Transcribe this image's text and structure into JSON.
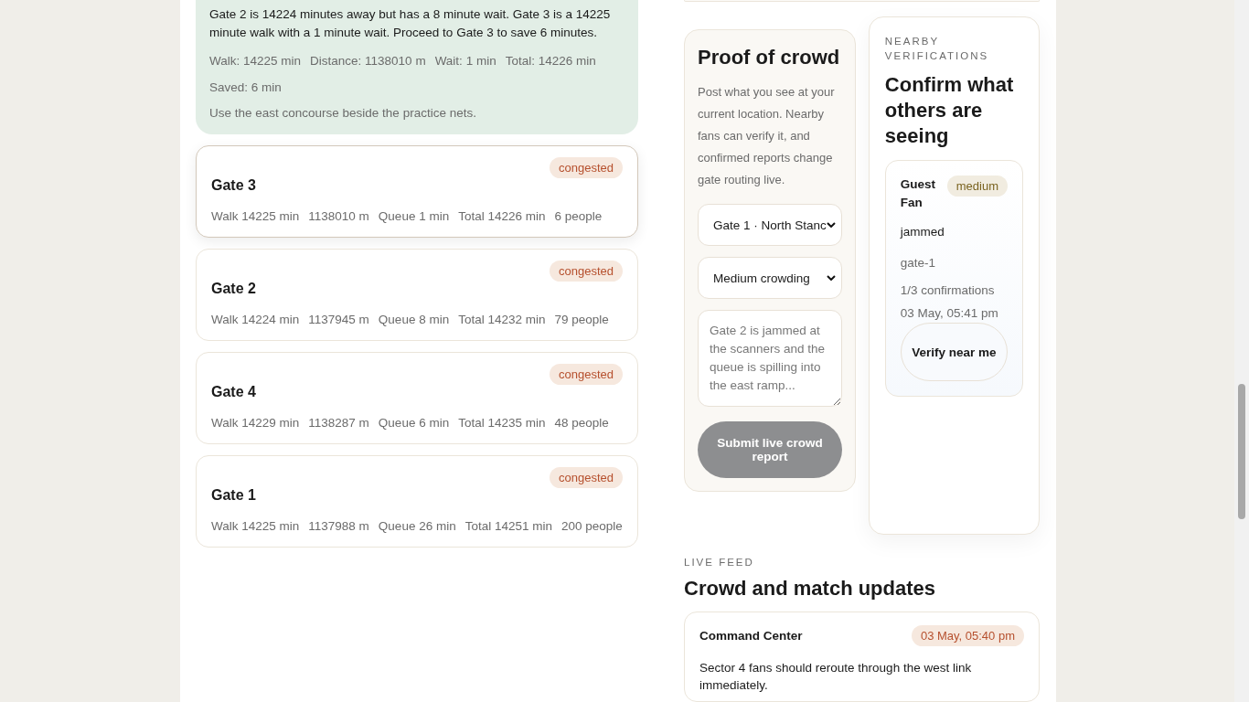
{
  "recommendation": {
    "message": "Gate 2 is 14224 minutes away but has a 8 minute wait. Gate 3 is a 14225 minute walk with a 1 minute wait. Proceed to Gate 3 to save 6 minutes.",
    "stats": [
      "Walk: 14225 min",
      "Distance: 1138010 m",
      "Wait: 1 min",
      "Total: 14226 min",
      "Saved: 6 min"
    ],
    "note": "Use the east concourse beside the practice nets."
  },
  "gates": [
    {
      "name": "Gate 3",
      "status": "congested",
      "selected": true,
      "stats": [
        "Walk 14225 min",
        "1138010 m",
        "Queue 1 min",
        "Total 14226 min",
        "6 people"
      ]
    },
    {
      "name": "Gate 2",
      "status": "congested",
      "selected": false,
      "stats": [
        "Walk 14224 min",
        "1137945 m",
        "Queue 8 min",
        "Total 14232 min",
        "79 people"
      ]
    },
    {
      "name": "Gate 4",
      "status": "congested",
      "selected": false,
      "stats": [
        "Walk 14229 min",
        "1138287 m",
        "Queue 6 min",
        "Total 14235 min",
        "48 people"
      ]
    },
    {
      "name": "Gate 1",
      "status": "congested",
      "selected": false,
      "stats": [
        "Walk 14225 min",
        "1137988 m",
        "Queue 26 min",
        "Total 14251 min",
        "200 people"
      ]
    }
  ],
  "proof": {
    "title": "Proof of crowd",
    "description": "Post what you see at your current location. Nearby fans can verify it, and confirmed reports change gate routing live.",
    "gate_select": "Gate 1 · North Stanc",
    "crowd_select": "Medium crowding",
    "report_placeholder": "Gate 2 is jammed at the scanners and the queue is spilling into the east ramp...",
    "submit": {
      "label": "Submit live crowd report",
      "disabled": true
    }
  },
  "verifications": {
    "eyebrow": "NEARBY VERIFICATIONS",
    "title": "Confirm what others are seeing",
    "items": [
      {
        "author": "Guest Fan",
        "severity": "medium",
        "status": "jammed",
        "gate": "gate-1",
        "confirmations": "1/3 confirmations",
        "time": "03 May, 05:41 pm",
        "button": "Verify near me"
      }
    ]
  },
  "feed": {
    "eyebrow": "LIVE FEED",
    "title": "Crowd and match updates",
    "items": [
      {
        "author": "Command Center",
        "time": "03 May, 05:40 pm",
        "message": "Sector 4 fans should reroute through the west link immediately."
      }
    ]
  }
}
